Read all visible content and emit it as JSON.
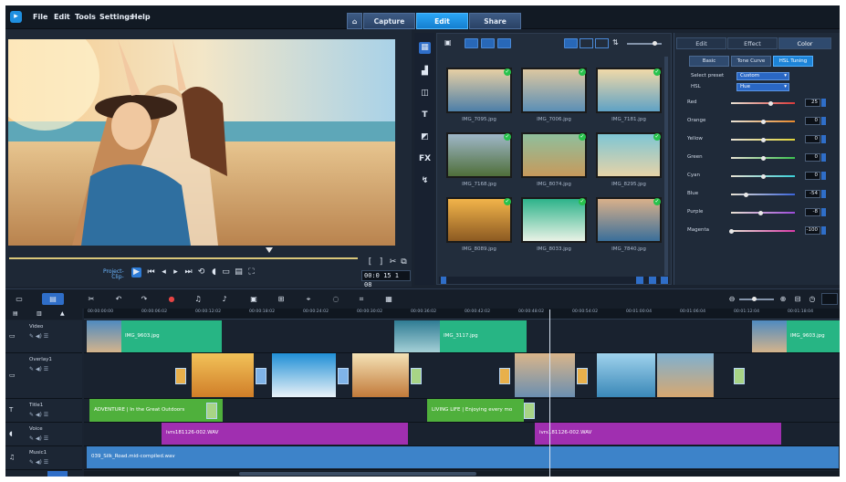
{
  "menu": [
    "File",
    "Edit",
    "Tools",
    "Settings",
    "Help"
  ],
  "tabs": [
    "Capture",
    "Edit",
    "Share"
  ],
  "active_tab": "Edit",
  "preview": {
    "project_label": "Project-",
    "clip_label": "Clip-",
    "timecode": "00:0 15 1 08"
  },
  "library": {
    "thumbs": [
      "IMG_7095.jpg",
      "IMG_7006.jpg",
      "IMG_7181.jpg",
      "IMG_7168.jpg",
      "IMG_8074.jpg",
      "IMG_8295.jpg",
      "IMG_8089.jpg",
      "IMG_8033.jpg",
      "IMG_7840.jpg"
    ]
  },
  "color_panel": {
    "tabs": [
      "Edit",
      "Effect",
      "Color"
    ],
    "active_tab": "Color",
    "subtabs": [
      "Basic",
      "Tone Curve",
      "HSL Tuning"
    ],
    "active_subtab": "HSL Tuning",
    "select_preset_label": "Select preset",
    "preset_value": "Custom",
    "hsl_label": "HSL",
    "hsl_value": "Hue",
    "sliders": [
      {
        "label": "Red",
        "value": "25",
        "fraction": 0.62,
        "color": "#d93a3a"
      },
      {
        "label": "Orange",
        "value": "0",
        "fraction": 0.5,
        "color": "#e8892c"
      },
      {
        "label": "Yellow",
        "value": "0",
        "fraction": 0.5,
        "color": "#e0d43a"
      },
      {
        "label": "Green",
        "value": "0",
        "fraction": 0.5,
        "color": "#3cc24f"
      },
      {
        "label": "Cyan",
        "value": "0",
        "fraction": 0.5,
        "color": "#3ad0d9"
      },
      {
        "label": "Blue",
        "value": "-54",
        "fraction": 0.23,
        "color": "#3a63d9"
      },
      {
        "label": "Purple",
        "value": "-8",
        "fraction": 0.46,
        "color": "#9b4ad9"
      },
      {
        "label": "Magenta",
        "value": "-100",
        "fraction": 0.0,
        "color": "#d93aa8"
      }
    ]
  },
  "ruler": [
    "00:00:00:00",
    "00:00:06:02",
    "00:00:12:02",
    "00:00:18:02",
    "00:00:24:02",
    "00:00:30:02",
    "00:00:36:02",
    "00:00:42:02",
    "00:00:48:02",
    "00:00:54:02",
    "00:01:00:04",
    "00:01:06:04",
    "00:01:12:04",
    "00:01:18:04"
  ],
  "tracks": [
    {
      "name": "Video"
    },
    {
      "name": "Overlay1"
    },
    {
      "name": "Title1"
    },
    {
      "name": "Voice"
    },
    {
      "name": "Music1"
    }
  ],
  "clips": {
    "video1": "IMG_9603.jpg",
    "video2": "IMG_3117.jpg",
    "video3": "IMG_9603.jpg",
    "title1": "ADVENTURE | In the Great Outdoors",
    "title2": "LIVING LIFE | Enjoying every mo",
    "voice1": "ivrs181126-002.WAV",
    "voice2": "ivrs181126-002.WAV",
    "music": "039_Silk_Road.mid-compiled.wav"
  },
  "colors": {
    "accent": "#1d84d8",
    "video_clip": "#27b584",
    "title_clip": "#4fb03c",
    "voice_clip": "#a02fb0",
    "music_clip": "#3d83c9"
  }
}
